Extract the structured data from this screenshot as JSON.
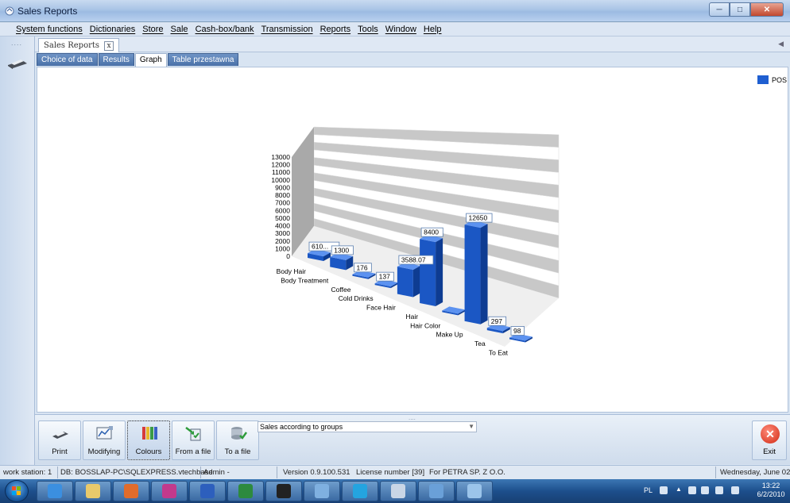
{
  "window": {
    "title": "Sales Reports"
  },
  "menu": [
    "System functions",
    "Dictionaries",
    "Store",
    "Sale",
    "Cash-box/bank",
    "Transmission",
    "Reports",
    "Tools",
    "Window",
    "Help"
  ],
  "doc_tab": {
    "label": "Sales Reports",
    "close": "x"
  },
  "subtabs": [
    {
      "label": "Choice of data",
      "active": false
    },
    {
      "label": "Results",
      "active": false
    },
    {
      "label": "Graph",
      "active": true
    },
    {
      "label": "Table przestawna",
      "active": false
    }
  ],
  "chart_data": {
    "type": "bar",
    "title": "",
    "legend": {
      "entries": [
        "POS"
      ],
      "placement": "top-right"
    },
    "series": [
      {
        "name": "POS",
        "color": "#1f5fd1",
        "values": [
          610,
          1300,
          176,
          137,
          3588.07,
          8400,
          0,
          12650,
          297,
          98
        ]
      }
    ],
    "categories": [
      "Body Hair",
      "Body Treatment",
      "Coffee",
      "Cold Drinks",
      "Face Hair",
      "Hair",
      "Hair Color",
      "Make Up",
      "Tea",
      "To Eat"
    ],
    "data_labels": [
      "610...",
      "1300",
      "176",
      "137",
      "3588.07",
      "8400",
      "",
      "12650",
      "297",
      "98"
    ],
    "y_ticks": [
      0,
      1000,
      2000,
      3000,
      4000,
      5000,
      6000,
      7000,
      8000,
      9000,
      10000,
      11000,
      12000,
      13000
    ],
    "ylim": [
      0,
      13000
    ],
    "grid": true,
    "three_d": true
  },
  "toolbar": {
    "buttons": [
      {
        "label": "Print",
        "icon": "printer-icon"
      },
      {
        "label": "Modifying",
        "icon": "chart-edit-icon"
      },
      {
        "label": "Colours",
        "icon": "colour-palette-icon",
        "active": true
      },
      {
        "label": "From a file",
        "icon": "import-file-icon"
      },
      {
        "label": "To a file",
        "icon": "export-file-icon"
      }
    ],
    "report_select": "Sales according to groups",
    "exit_label": "Exit"
  },
  "status": {
    "workstation": "work station: 1",
    "db": "DB: BOSSLAP-PC\\SQLEXPRESS.vtechbase",
    "user": "Admin -",
    "version": "Version 0.9.100.531",
    "license": "License number [39]",
    "licensee": "For PETRA SP. Z O.O.",
    "date": "Wednesday, June 02,"
  },
  "taskbar": {
    "lang": "PL",
    "time": "13:22",
    "date": "6/2/2010",
    "apps": [
      "ie-icon",
      "folder-icon",
      "media-player-icon",
      "paint-app-icon",
      "word-icon",
      "excel-icon",
      "cmd-icon",
      "app-icon",
      "skype-icon",
      "app-icon",
      "paint-icon",
      "app-icon"
    ]
  }
}
